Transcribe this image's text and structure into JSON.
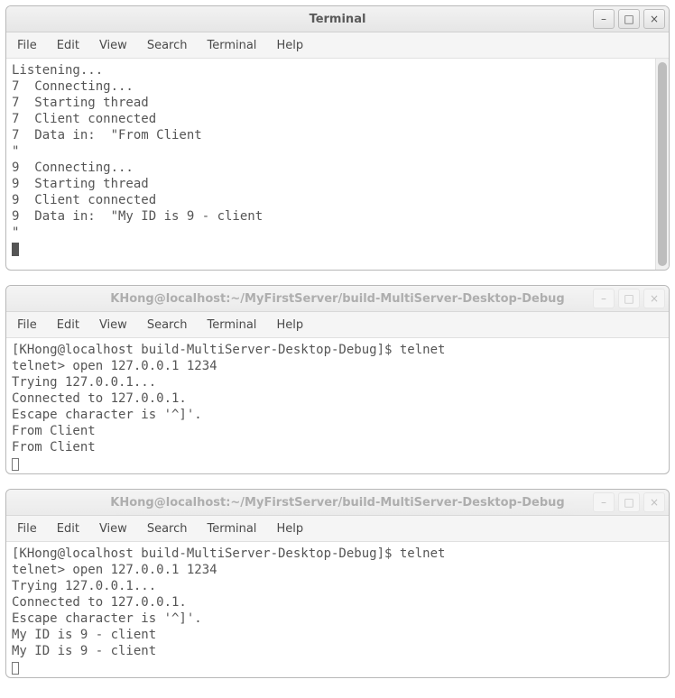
{
  "menus": {
    "file": "File",
    "edit": "Edit",
    "view": "View",
    "search": "Search",
    "terminal": "Terminal",
    "help": "Help"
  },
  "windows": [
    {
      "title": "Terminal",
      "active": true,
      "body_height": 234,
      "thumb_height": 226,
      "cursor_style": "block",
      "lines": [
        "Listening...",
        "7  Connecting...",
        "7  Starting thread",
        "7  Client connected",
        "7  Data in:  \"From Client",
        "\"",
        "9  Connecting...",
        "9  Starting thread",
        "9  Client connected",
        "9  Data in:  \"My ID is 9 - client",
        "\"",
        ""
      ]
    },
    {
      "title": "KHong@localhost:~/MyFirstServer/build-MultiServer-Desktop-Debug",
      "active": false,
      "body_height": 150,
      "thumb_height": 0,
      "cursor_style": "hollow",
      "lines": [
        "[KHong@localhost build-MultiServer-Desktop-Debug]$ telnet",
        "telnet> open 127.0.0.1 1234",
        "Trying 127.0.0.1...",
        "Connected to 127.0.0.1.",
        "Escape character is '^]'.",
        "From Client",
        "From Client",
        ""
      ]
    },
    {
      "title": "KHong@localhost:~/MyFirstServer/build-MultiServer-Desktop-Debug",
      "active": false,
      "body_height": 150,
      "thumb_height": 0,
      "cursor_style": "hollow",
      "lines": [
        "[KHong@localhost build-MultiServer-Desktop-Debug]$ telnet",
        "telnet> open 127.0.0.1 1234",
        "Trying 127.0.0.1...",
        "Connected to 127.0.0.1.",
        "Escape character is '^]'.",
        "My ID is 9 - client",
        "My ID is 9 - client",
        ""
      ]
    }
  ],
  "icons": {
    "minimize": "–",
    "maximize": "□",
    "close": "×"
  }
}
